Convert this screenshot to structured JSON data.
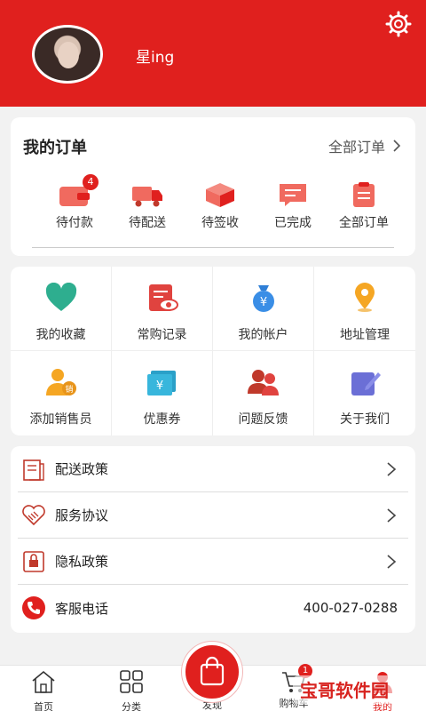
{
  "header": {
    "username": "星ing",
    "accent": "#e0201e"
  },
  "orders": {
    "title": "我的订单",
    "all_label": "全部订单",
    "items": [
      {
        "label": "待付款",
        "icon": "wallet-icon",
        "badge": "4"
      },
      {
        "label": "待配送",
        "icon": "truck-icon"
      },
      {
        "label": "待签收",
        "icon": "package-icon"
      },
      {
        "label": "已完成",
        "icon": "message-icon"
      },
      {
        "label": "全部订单",
        "icon": "clipboard-icon"
      }
    ]
  },
  "services": [
    {
      "label": "我的收藏",
      "icon": "heart-icon"
    },
    {
      "label": "常购记录",
      "icon": "record-icon"
    },
    {
      "label": "我的帐户",
      "icon": "money-bag-icon"
    },
    {
      "label": "地址管理",
      "icon": "location-pin-icon"
    },
    {
      "label": "添加销售员",
      "icon": "add-salesperson-icon"
    },
    {
      "label": "优惠券",
      "icon": "coupon-icon"
    },
    {
      "label": "问题反馈",
      "icon": "feedback-icon"
    },
    {
      "label": "关于我们",
      "icon": "edit-icon"
    }
  ],
  "menu": [
    {
      "label": "配送政策",
      "icon": "document-icon"
    },
    {
      "label": "服务协议",
      "icon": "handshake-icon"
    },
    {
      "label": "隐私政策",
      "icon": "privacy-icon"
    },
    {
      "label": "客服电话",
      "icon": "phone-icon",
      "value": "400-027-0288"
    }
  ],
  "tabbar": {
    "home": "首页",
    "category": "分类",
    "discover": "发现",
    "cart": "购物车",
    "cart_badge": "1",
    "mine": "我的"
  },
  "watermark": "宝哥软件园"
}
